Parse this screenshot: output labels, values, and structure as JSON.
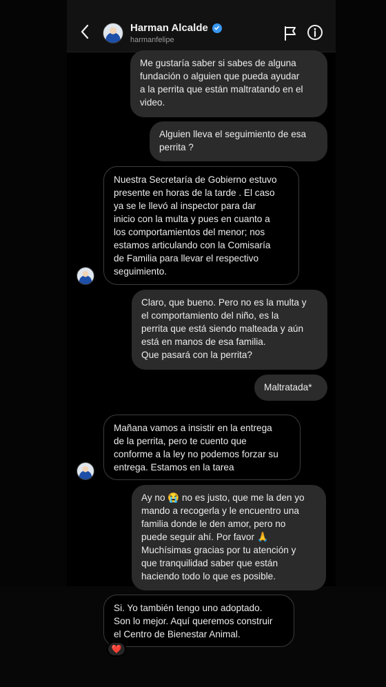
{
  "header": {
    "display_name": "Harman Alcalde",
    "username": "harmanfelipe"
  },
  "messages": [
    {
      "direction": "out",
      "text": "Me gustaría saber si sabes de alguna\nfundación o alguien que pueda ayudar\na la perrita que están maltratando en el\nvideo."
    },
    {
      "direction": "out",
      "text": "Alguien lleva el seguimiento de esa\nperrita ?"
    },
    {
      "direction": "in",
      "text": "Nuestra Secretaría de Gobierno estuvo\npresente en horas de la tarde . El caso\nya se le llevó al inspector para dar\ninicio con la multa y pues en cuanto a\nlos comportamientos del menor; nos\nestamos articulando con la Comisaría\nde Familia para llevar el respectivo\nseguimiento."
    },
    {
      "direction": "out",
      "text": "Claro, que bueno. Pero no es la multa y\nel comportamiento del niño, es la\nperrita que está siendo malteada y aún\nestá en manos de esa familia.\nQue pasará con la perrita?"
    },
    {
      "direction": "out",
      "text": "Maltratada*"
    },
    {
      "direction": "in",
      "text": "Mañana vamos a insistir en la entrega\nde la perrita, pero te cuento que\nconforme a la ley no podemos forzar su\nentrega.  Estamos en la tarea"
    },
    {
      "direction": "out",
      "text": "Ay no 😭 no es justo, que me la den yo\nmando a recogerla y le encuentro una\nfamilia donde le den amor, pero no\npuede seguir ahí. Por favor 🙏\nMuchísimas gracias por tu atención y\nque tranquilidad saber que están\nhaciendo todo lo que es posible."
    },
    {
      "direction": "in",
      "text": "Si. Yo también tengo uno adoptado.\nSon lo mejor. Aquí queremos construir\nel Centro de Bienestar Animal."
    }
  ],
  "reaction": {
    "emoji": "❤️"
  },
  "icons": {
    "back": "chevron-left-icon",
    "verified": "verified-badge-icon",
    "flag": "flag-icon",
    "info": "info-icon"
  },
  "colors": {
    "background": "#000000",
    "outgoing_bubble": "#2b2b2b",
    "incoming_border": "#3c3c3c",
    "verified": "#3897f0"
  }
}
